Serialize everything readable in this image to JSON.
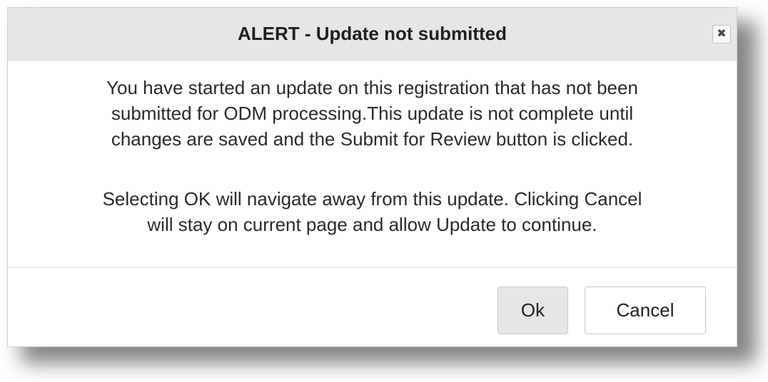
{
  "dialog": {
    "title": "ALERT - Update not submitted",
    "close_icon": "close-icon",
    "close_glyph": "✖",
    "paragraph_1": {
      "line_1": "You have started an update on this registration that has not been",
      "line_2": "submitted for ODM processing.This update is not complete until",
      "line_3": "changes are saved and the Submit for Review button is clicked."
    },
    "paragraph_2": {
      "line_1": "Selecting OK will navigate away from this update. Clicking Cancel",
      "line_2": "will stay on current page and allow Update to continue."
    },
    "buttons": {
      "ok_label": "Ok",
      "cancel_label": "Cancel"
    }
  },
  "colors": {
    "titlebar_bg": "#e6e6e6",
    "ok_button_bg": "#e6e6e6",
    "text": "#2a2a2a"
  }
}
